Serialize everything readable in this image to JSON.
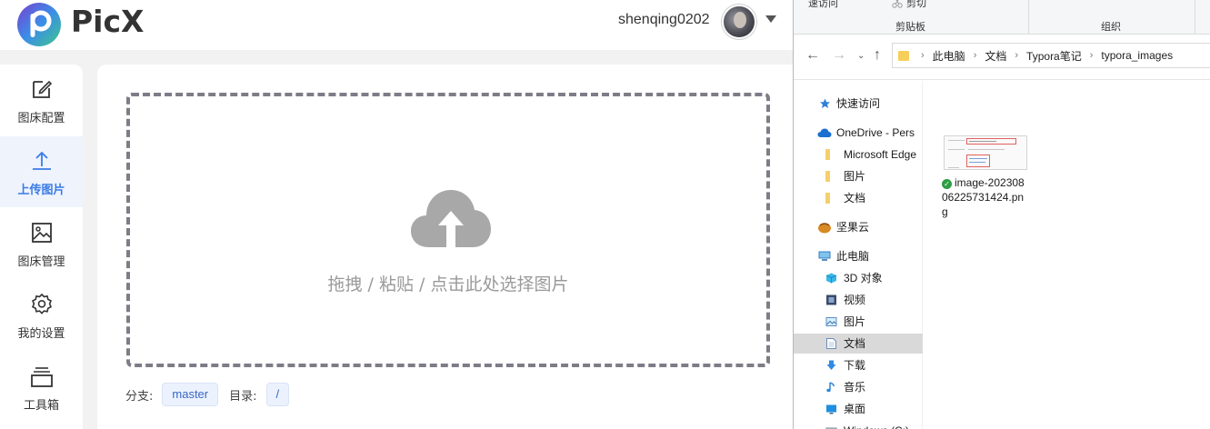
{
  "app": {
    "name": "PicX",
    "user": {
      "name": "shenqing0202"
    },
    "colors": {
      "accent": "#3a7be6",
      "active_bg": "#eef3fc"
    }
  },
  "sidebar": {
    "items": [
      {
        "label": "图床配置",
        "icon": "edit-icon",
        "active": false
      },
      {
        "label": "上传图片",
        "icon": "upload-icon",
        "active": true
      },
      {
        "label": "图床管理",
        "icon": "image-icon",
        "active": false
      },
      {
        "label": "我的设置",
        "icon": "gear-icon",
        "active": false
      },
      {
        "label": "工具箱",
        "icon": "toolbox-icon",
        "active": false
      }
    ]
  },
  "upload": {
    "prompt": "拖拽 / 粘贴 / 点击此处选择图片",
    "branch_label": "分支:",
    "branch_value": "master",
    "dir_label": "目录:",
    "dir_value": "/"
  },
  "explorer": {
    "ribbon": {
      "quick_access": "速访问",
      "cut": "剪切",
      "clipboard_group": "剪贴板",
      "organize_group": "组织"
    },
    "breadcrumb": [
      "此电脑",
      "文档",
      "Typora笔记",
      "typora_images"
    ],
    "nav_items": [
      {
        "label": "快速访问",
        "icon": "star-icon"
      },
      {
        "label": "OneDrive - Pers",
        "icon": "cloud-icon"
      },
      {
        "label": "Microsoft Edge",
        "icon": "folder-icon"
      },
      {
        "label": "图片",
        "icon": "folder-icon"
      },
      {
        "label": "文档",
        "icon": "folder-icon"
      },
      {
        "label": "坚果云",
        "icon": "nut-icon"
      },
      {
        "label": "此电脑",
        "icon": "computer-icon"
      },
      {
        "label": "3D 对象",
        "icon": "cube-icon"
      },
      {
        "label": "视频",
        "icon": "video-icon"
      },
      {
        "label": "图片",
        "icon": "picture-icon"
      },
      {
        "label": "文档",
        "icon": "document-icon",
        "selected": true
      },
      {
        "label": "下载",
        "icon": "download-icon"
      },
      {
        "label": "音乐",
        "icon": "music-icon"
      },
      {
        "label": "桌面",
        "icon": "desktop-icon"
      },
      {
        "label": "Windows (C:)",
        "icon": "drive-icon"
      }
    ],
    "files": [
      {
        "name": "image-20230806225731424.png",
        "status": "synced-check-icon"
      }
    ]
  }
}
